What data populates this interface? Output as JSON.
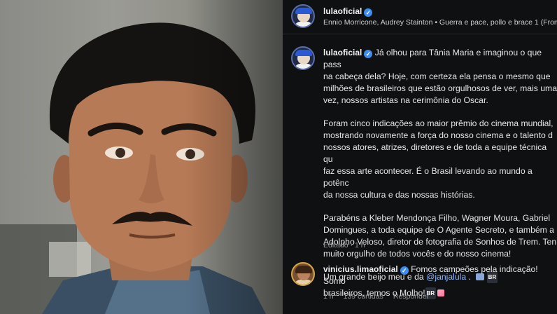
{
  "post": {
    "author": "lulaoficial",
    "music": "Ennio Morricone, Audrey Stainton • Guerra e pace, pollo e brace 1 (From"
  },
  "caption": {
    "author": "lulaoficial",
    "p1": "Já olhou para Tânia Maria e imaginou o que pass\nna cabeça dela? Hoje, com certeza ela pensa o mesmo que\nmilhões de brasileiros que estão orgulhosos de ver, mais uma\nvez, nossos artistas na cerimônia do Oscar.",
    "p2": "Foram cinco indicações ao maior prêmio do cinema mundial,\nmostrando novamente a força do nosso cinema e o talento d\nnossos atores, atrizes, diretores e de toda a equipe técnica qu\nfaz essa arte acontecer. É o Brasil levando ao mundo a potênc\nda nossa cultura e das nossas histórias.",
    "p3": "Parabéns a Kleber Mendonça Filho, Wagner Moura, Gabriel\nDomingues, a toda equipe de O Agente Secreto, e também a\nAdolpho Veloso, diretor de fotografia de Sonhos de Trem. Ten\nmuito orgulho de todos vocês e do nosso cinema!",
    "p4_text": "Um grande beijo meu e da ",
    "mention": "@janjalula",
    "p4_suffix": " . ",
    "flag": "BR",
    "edited": "Editado · 1 h"
  },
  "reply": {
    "author": "vinicius.limaoficial",
    "text_line1": "Fomos campeões pela indicação! Somo",
    "text_line2": "brasileiros, temos o Molho!",
    "flag": "BR",
    "time": "1 h",
    "likes": "139 curtidas",
    "reply_label": "Responder"
  },
  "colors": {
    "verified": "#3b8ef2",
    "mention": "#8fb7ff",
    "panel_bg": "#0f1012"
  },
  "icons": [
    "verified-badge-icon",
    "flag-icon",
    "film-emoji-icon",
    "sparkle-emoji-icon"
  ]
}
